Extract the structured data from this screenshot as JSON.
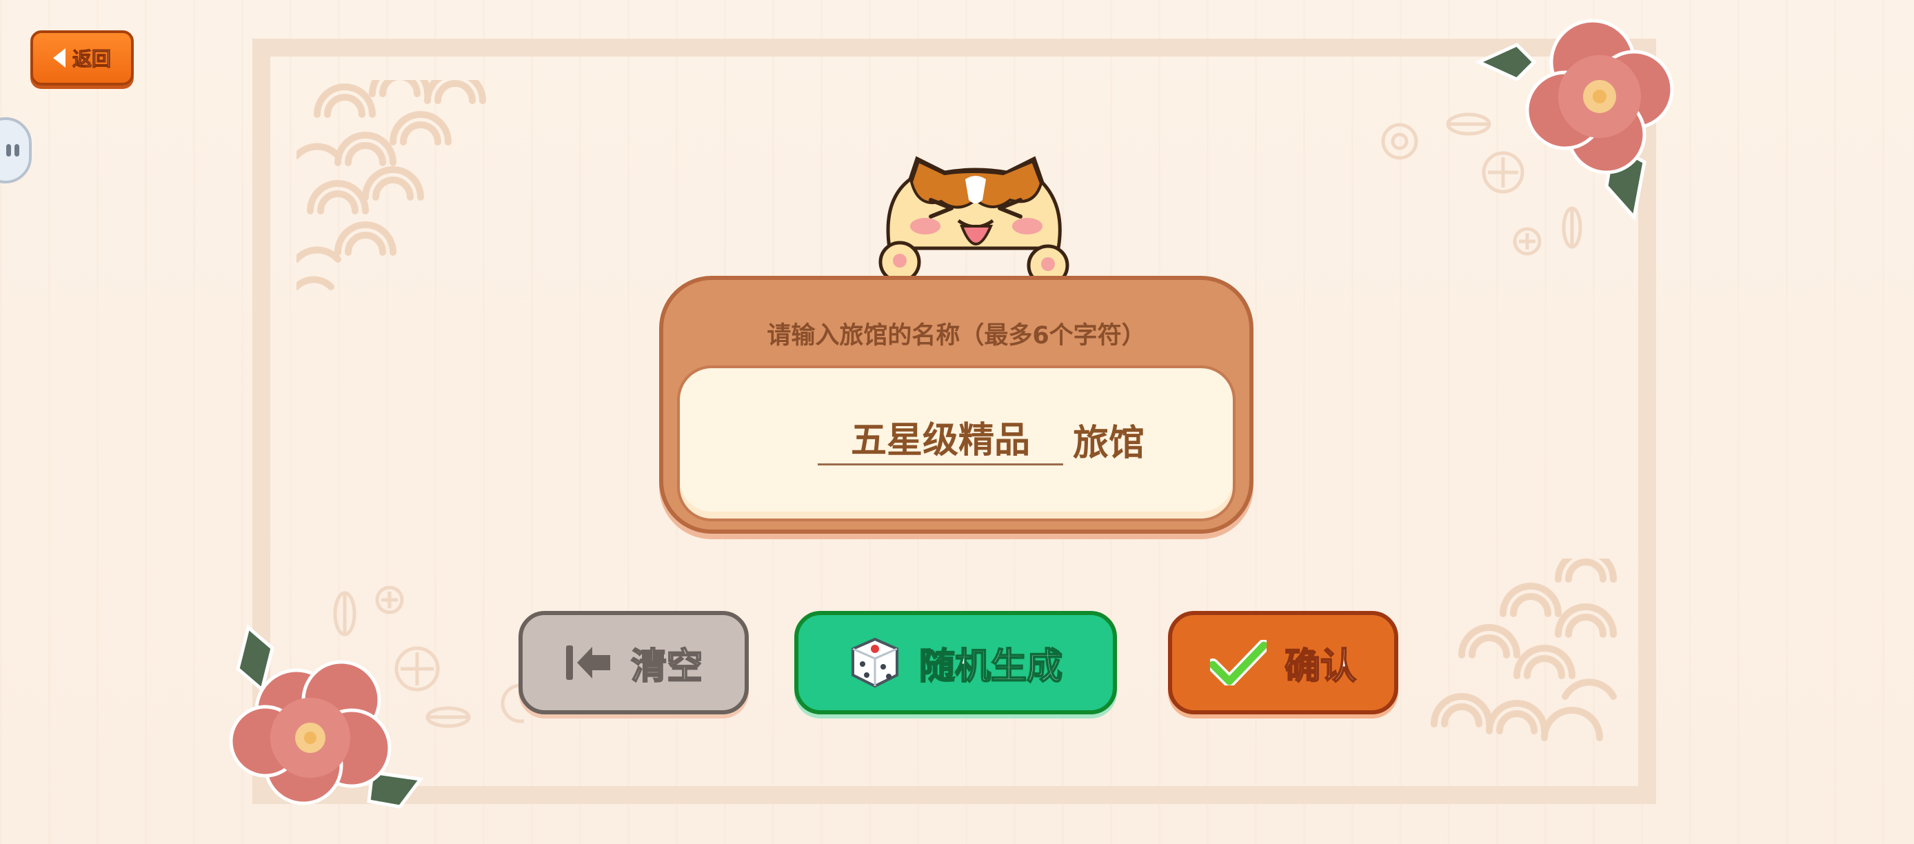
{
  "header": {
    "back_label": "返回"
  },
  "dialog": {
    "prompt": "请输入旅馆的名称（最多6个字符）",
    "name_value": "五星级精品",
    "name_suffix": "旅馆"
  },
  "actions": {
    "clear_label": "清空",
    "random_label": "随机生成",
    "confirm_label": "确认"
  },
  "icons": {
    "back": "caret-left-icon",
    "clear": "backspace-icon",
    "random": "dice-icon",
    "confirm": "checkmark-icon",
    "side_handle": "side-handle-icon"
  },
  "colors": {
    "background": "#fdf0e4",
    "frame": "#f2dfcd",
    "back_button": "#f27318",
    "panel": "#d99263",
    "panel_inner": "#fff5e3",
    "clear_button": "#c9beb8",
    "random_button": "#21c887",
    "confirm_button": "#e26d22",
    "camellia": "#d97a72",
    "text_brown": "#8b5327"
  }
}
